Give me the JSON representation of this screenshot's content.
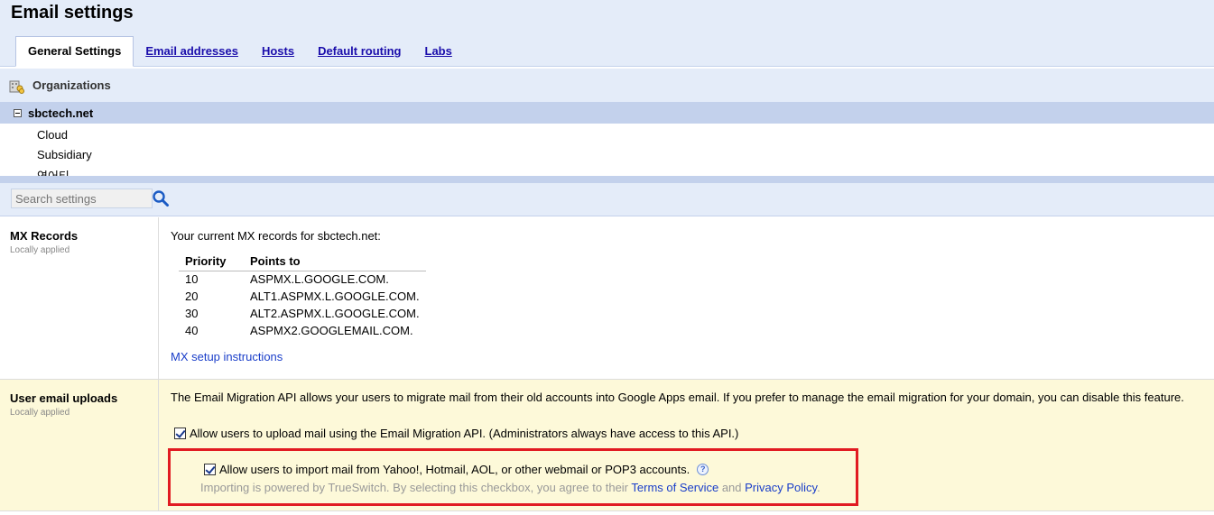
{
  "header": {
    "title": "Email settings",
    "tabs": [
      {
        "label": "General Settings",
        "active": true
      },
      {
        "label": "Email addresses"
      },
      {
        "label": "Hosts"
      },
      {
        "label": "Default routing"
      },
      {
        "label": "Labs"
      }
    ]
  },
  "orgs": {
    "title": "Organizations",
    "selected": "sbctech.net",
    "children": [
      "Cloud",
      "Subsidiary",
      "연어티"
    ]
  },
  "search": {
    "placeholder": "Search settings"
  },
  "mx": {
    "title": "MX Records",
    "subtitle": "Locally applied",
    "intro": "Your current MX records for sbctech.net:",
    "columns": [
      "Priority",
      "Points to"
    ],
    "rows": [
      [
        "10",
        "ASPMX.L.GOOGLE.COM."
      ],
      [
        "20",
        "ALT1.ASPMX.L.GOOGLE.COM."
      ],
      [
        "30",
        "ALT2.ASPMX.L.GOOGLE.COM."
      ],
      [
        "40",
        "ASPMX2.GOOGLEMAIL.COM."
      ]
    ],
    "link": "MX setup instructions"
  },
  "uploads": {
    "title": "User email uploads",
    "subtitle": "Locally applied",
    "description": "The Email Migration API allows your users to migrate mail from their old accounts into Google Apps email. If you prefer to manage the email migration for your domain, you can disable this feature.",
    "option1": "Allow users to upload mail using the Email Migration API. (Administrators always have access to this API.)",
    "option2": "Allow users to import mail from Yahoo!, Hotmail, AOL, or other webmail or POP3 accounts.",
    "note_prefix": "Importing is powered by TrueSwitch. By selecting this checkbox, you agree to their ",
    "terms": "Terms of Service",
    "and": " and ",
    "privacy": "Privacy Policy",
    "period": "."
  },
  "colors": {
    "accent": "#c3d1ec",
    "header_bg": "#e4ecf9",
    "highlight": "#e11b22",
    "section_bg": "#fdf9d9"
  }
}
